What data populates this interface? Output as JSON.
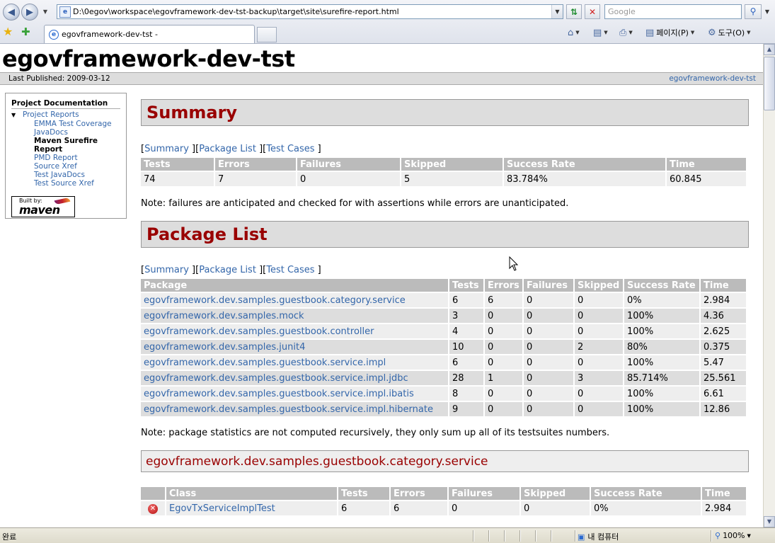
{
  "browser": {
    "address": "D:\\0egov\\workspace\\egovframework-dev-tst-backup\\target\\site\\surefire-report.html",
    "search_placeholder": "Google",
    "tab_title": "egovframework-dev-tst -",
    "cmd_page": "페이지(P)",
    "cmd_tools": "도구(O)",
    "status_text": "완료",
    "zone": "내 컴퓨터",
    "zoom": "100%"
  },
  "site": {
    "title": "egovframework-dev-tst",
    "last_published": "Last Published: 2009-03-12",
    "breadcrumb_right": "egovframework-dev-tst"
  },
  "nav": {
    "heading": "Project Documentation",
    "reports_label": "Project Reports",
    "items": [
      {
        "label": "EMMA Test Coverage"
      },
      {
        "label": "JavaDocs"
      },
      {
        "label": "Maven Surefire Report"
      },
      {
        "label": "PMD Report"
      },
      {
        "label": "Source Xref"
      },
      {
        "label": "Test JavaDocs"
      },
      {
        "label": "Test Source Xref"
      }
    ],
    "powered_by": "Built by:",
    "powered_name": "maven"
  },
  "links": {
    "summary": "Summary",
    "package_list": "Package List",
    "test_cases": "Test Cases"
  },
  "summary": {
    "heading": "Summary",
    "headers": [
      "Tests",
      "Errors",
      "Failures",
      "Skipped",
      "Success Rate",
      "Time"
    ],
    "row": [
      "74",
      "7",
      "0",
      "5",
      "83.784%",
      "60.845"
    ],
    "note": "Note: failures are anticipated and checked for with assertions while errors are unanticipated."
  },
  "packages": {
    "heading": "Package List",
    "headers": [
      "Package",
      "Tests",
      "Errors",
      "Failures",
      "Skipped",
      "Success Rate",
      "Time"
    ],
    "rows": [
      [
        "egovframework.dev.samples.guestbook.category.service",
        "6",
        "6",
        "0",
        "0",
        "0%",
        "2.984"
      ],
      [
        "egovframework.dev.samples.mock",
        "3",
        "0",
        "0",
        "0",
        "100%",
        "4.36"
      ],
      [
        "egovframework.dev.samples.guestbook.controller",
        "4",
        "0",
        "0",
        "0",
        "100%",
        "2.625"
      ],
      [
        "egovframework.dev.samples.junit4",
        "10",
        "0",
        "0",
        "2",
        "80%",
        "0.375"
      ],
      [
        "egovframework.dev.samples.guestbook.service.impl",
        "6",
        "0",
        "0",
        "0",
        "100%",
        "5.47"
      ],
      [
        "egovframework.dev.samples.guestbook.service.impl.jdbc",
        "28",
        "1",
        "0",
        "3",
        "85.714%",
        "25.561"
      ],
      [
        "egovframework.dev.samples.guestbook.service.impl.ibatis",
        "8",
        "0",
        "0",
        "0",
        "100%",
        "6.61"
      ],
      [
        "egovframework.dev.samples.guestbook.service.impl.hibernate",
        "9",
        "0",
        "0",
        "0",
        "100%",
        "12.86"
      ]
    ],
    "note": "Note: package statistics are not computed recursively, they only sum up all of its testsuites numbers."
  },
  "category": {
    "heading": "egovframework.dev.samples.guestbook.category.service",
    "headers": [
      "",
      "Class",
      "Tests",
      "Errors",
      "Failures",
      "Skipped",
      "Success Rate",
      "Time"
    ],
    "row": [
      "EgovTxServiceImplTest",
      "6",
      "6",
      "0",
      "0",
      "0%",
      "2.984"
    ],
    "status_icon": "error-icon"
  }
}
